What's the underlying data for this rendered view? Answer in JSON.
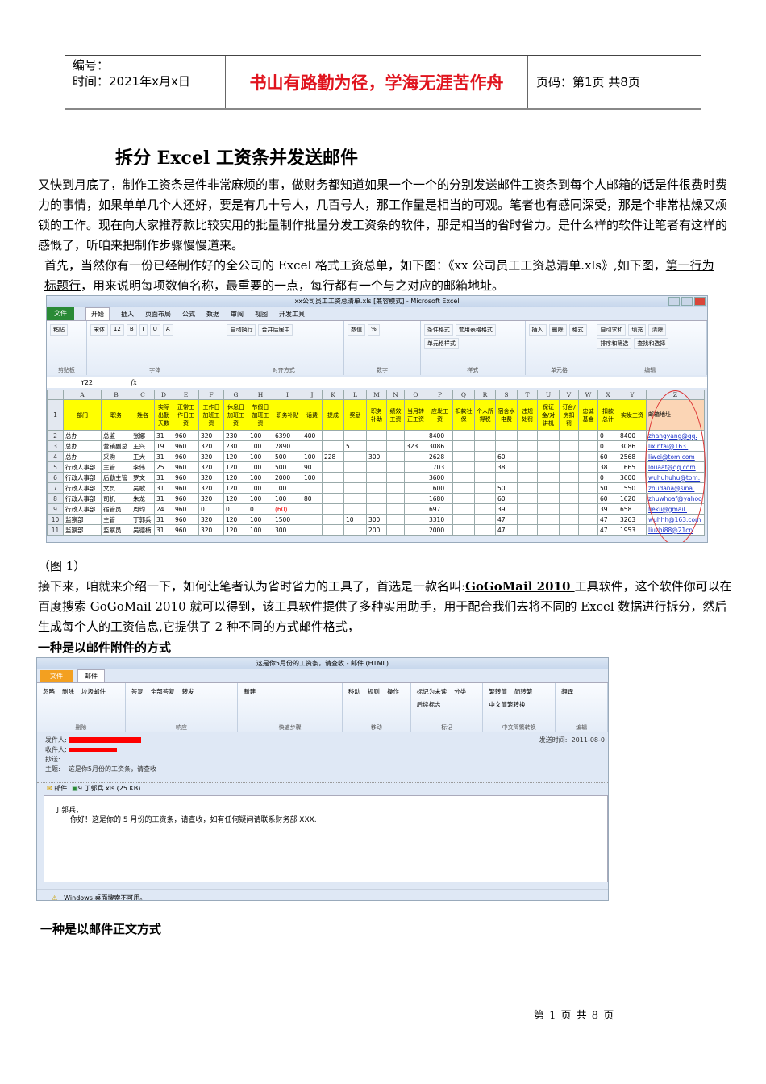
{
  "header": {
    "number_label": "编号：",
    "time_label": "时间：2021年x月x日",
    "motto": "书山有路勤为径，学海无涯苦作舟",
    "page_label": "页码：第1页  共8页"
  },
  "title": "拆分 Excel 工资条并发送邮件",
  "paragraphs": {
    "p1": "又快到月底了，制作工资条是件非常麻烦的事，做财务都知道如果一个一个的分别发送邮件工资条到每个人邮箱的话是件很费时费力的事情，如果单单几个人还好，要是有几十号人，几百号人，那工作量是相当的可观。笔者也有感同深受，那是个非常枯燥又烦锁的工作。现在向大家推荐款比较实用的批量制作批量分发工资条的软件，那是相当的省时省力。是什么样的软件让笔者有这样的感慨了，听咱来把制作步骤慢慢道来。",
    "p2a": "首先，当然你有一份已经制作好的全公司的 Excel 格式工资总单，如下图：《xx 公司员工工资总清单.xls》,如下图，",
    "p2b": "第一行为标题行",
    "p2c": "，用来说明每项数值名称，最重要的一点，每行都有一个与之对应的邮箱地址。",
    "caption": "（图 1）",
    "p3a": "接下来，咱就来介绍一下，如何让笔者认为省时省力的工具了，首选是一款名叫:",
    "p3b": "GoGoMail 2010 ",
    "p3c": "工具软件，这个软件你可以在百度搜索 GoGoMail 2010 就可以得到，该工具软件提供了多种实用助手，用于配合我们去将不同的 Excel 数据进行拆分，然后生成每个人的工资信息,它提供了 2 种不同的方式邮件格式，",
    "h_attach": "一种是以邮件附件的方式",
    "h_body": "一种是以邮件正文方式"
  },
  "excel": {
    "window_title": "xx公司员工工资总清单.xls  [兼容模式] - Microsoft Excel",
    "tabs": [
      "文件",
      "开始",
      "插入",
      "页面布局",
      "公式",
      "数据",
      "审阅",
      "视图",
      "开发工具"
    ],
    "groups": [
      {
        "label": "剪贴板",
        "buttons": [
          "粘贴"
        ]
      },
      {
        "label": "字体",
        "buttons": [
          "宋体",
          "12",
          "B",
          "I",
          "U",
          "A"
        ]
      },
      {
        "label": "对齐方式",
        "buttons": [
          "自动换行",
          "合并后居中"
        ]
      },
      {
        "label": "数字",
        "buttons": [
          "数值",
          "%"
        ]
      },
      {
        "label": "样式",
        "buttons": [
          "条件格式",
          "套用表格格式",
          "单元格样式"
        ]
      },
      {
        "label": "单元格",
        "buttons": [
          "插入",
          "删除",
          "格式"
        ]
      },
      {
        "label": "编辑",
        "buttons": [
          "自动求和",
          "填充",
          "清除",
          "排序和筛选",
          "查找和选择"
        ]
      }
    ],
    "name_box": "Y22",
    "fx": "fx",
    "columns": [
      "A",
      "B",
      "C",
      "D",
      "E",
      "F",
      "G",
      "H",
      "I",
      "J",
      "K",
      "L",
      "M",
      "N",
      "O",
      "P",
      "Q",
      "R",
      "S",
      "T",
      "U",
      "V",
      "W",
      "X",
      "Y",
      "Z"
    ],
    "headers": [
      "部门",
      "职务",
      "姓名",
      "实际出勤天数",
      "正常工作日工资",
      "工作日加班工资",
      "休息日加班工资",
      "节假日加班工资",
      "职务补贴",
      "话费",
      "提成",
      "奖励",
      "职务补助",
      "绩效工资",
      "当月转正工资",
      "应发工资",
      "扣款社保",
      "个人所得税",
      "宿舍水电费",
      "违规处罚",
      "保证金/对讲机",
      "订台/房扣罚",
      "忠诚基金",
      "扣款总计",
      "实发工资",
      "邮箱地址"
    ],
    "rows": [
      [
        "总办",
        "总监",
        "张娜",
        "31",
        "960",
        "320",
        "230",
        "100",
        "6390",
        "400",
        "",
        "",
        "",
        "",
        "",
        "8400",
        "",
        "",
        "",
        "",
        "",
        "",
        "",
        "0",
        "8400",
        "zhangyang@qq."
      ],
      [
        "总办",
        "营销副总",
        "王兴",
        "19",
        "960",
        "320",
        "230",
        "100",
        "2890",
        "",
        "",
        "5",
        "",
        "",
        "323",
        "3086",
        "",
        "",
        "",
        "",
        "",
        "",
        "",
        "0",
        "3086",
        "lixintai@163."
      ],
      [
        "总办",
        "采购",
        "王大",
        "31",
        "960",
        "320",
        "120",
        "100",
        "500",
        "100",
        "228",
        "",
        "300",
        "",
        "",
        "2628",
        "",
        "",
        "60",
        "",
        "",
        "",
        "",
        "60",
        "2568",
        "liwei@tom.com"
      ],
      [
        "行政人事部",
        "主管",
        "李伟",
        "25",
        "960",
        "320",
        "120",
        "100",
        "500",
        "90",
        "",
        "",
        "",
        "",
        "",
        "1703",
        "",
        "",
        "38",
        "",
        "",
        "",
        "",
        "38",
        "1665",
        "louaaf@qq.com"
      ],
      [
        "行政人事部",
        "后勤主管",
        "罗文",
        "31",
        "960",
        "320",
        "120",
        "100",
        "2000",
        "100",
        "",
        "",
        "",
        "",
        "",
        "3600",
        "",
        "",
        "",
        "",
        "",
        "",
        "",
        "0",
        "3600",
        "wuhuhuhu@tom."
      ],
      [
        "行政人事部",
        "文员",
        "吴歌",
        "31",
        "960",
        "320",
        "120",
        "100",
        "100",
        "",
        "",
        "",
        "",
        "",
        "",
        "1600",
        "",
        "",
        "50",
        "",
        "",
        "",
        "",
        "50",
        "1550",
        "zhudana@sina."
      ],
      [
        "行政人事部",
        "司机",
        "朱龙",
        "31",
        "960",
        "320",
        "120",
        "100",
        "100",
        "80",
        "",
        "",
        "",
        "",
        "",
        "1680",
        "",
        "",
        "60",
        "",
        "",
        "",
        "",
        "60",
        "1620",
        "zhuwhoaf@yahoo"
      ],
      [
        "行政人事部",
        "宿管员",
        "周均",
        "24",
        "960",
        "0",
        "0",
        "0",
        "(60)",
        "",
        "",
        "",
        "",
        "",
        "",
        "697",
        "",
        "",
        "39",
        "",
        "",
        "",
        "",
        "39",
        "658",
        "liekii@gmail."
      ],
      [
        "监察部",
        "主管",
        "丁郭兵",
        "31",
        "960",
        "320",
        "120",
        "100",
        "1500",
        "",
        "",
        "10",
        "300",
        "",
        "",
        "3310",
        "",
        "",
        "47",
        "",
        "",
        "",
        "",
        "47",
        "3263",
        "wuhhh@163.com"
      ],
      [
        "监察部",
        "监察员",
        "吴德楠",
        "31",
        "960",
        "320",
        "120",
        "100",
        "300",
        "",
        "",
        "",
        "200",
        "",
        "",
        "2000",
        "",
        "",
        "47",
        "",
        "",
        "",
        "",
        "47",
        "1953",
        "liuzhi88@21cn"
      ]
    ]
  },
  "email": {
    "window_title": "这是你5月份的工资条，请查收 - 邮件 (HTML)",
    "tabs": [
      "文件",
      "邮件"
    ],
    "groups": [
      {
        "label": "删除",
        "buttons": [
          "忽略",
          "删除",
          "垃圾邮件"
        ]
      },
      {
        "label": "响应",
        "buttons": [
          "答复",
          "全部答复",
          "转发"
        ]
      },
      {
        "label": "快速步骤",
        "buttons": [
          "新建"
        ]
      },
      {
        "label": "移动",
        "buttons": [
          "移动",
          "规则",
          "操作"
        ]
      },
      {
        "label": "标记",
        "buttons": [
          "标记为未读",
          "分类",
          "后续标志"
        ]
      },
      {
        "label": "中文简繁转换",
        "buttons": [
          "繁转简",
          "简转繁",
          "中文简繁转换"
        ]
      },
      {
        "label": "编辑",
        "buttons": [
          "翻译"
        ]
      }
    ],
    "from_label": "发件人:",
    "to_label": "收件人:",
    "cc_label": "抄送:",
    "subject_label": "主题:",
    "subject": "这是你5月份的工资条，请查收",
    "sent_label": "发送时间:",
    "sent_value": "2011-08-0",
    "message_tab": "邮件",
    "attachment": "9.丁郭兵.xls (25 KB)",
    "greeting": "丁郭兵，",
    "body": "你好！这是你的 5 月份的工资条，请查收，如有任何疑问请联系财务部 XXX.",
    "status": "Windows 桌面搜索不可用。"
  },
  "footer": "第 1 页 共 8 页"
}
